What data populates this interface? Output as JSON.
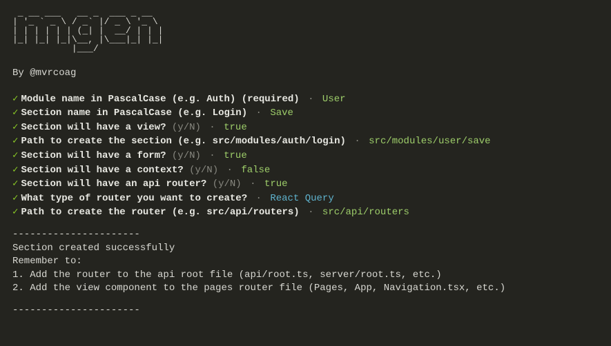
{
  "ascii_art": " _ __ ___   __ _  ___ _ __  \n| '_ ` _ \\ / _` |/ _ \\ '_ \\ \n| | | | | | (_| |  __/ | | |\n|_| |_| |_|\\__, |\\___|_| |_|\n           |___/            ",
  "byline": "By @mvrcoag",
  "prompts": [
    {
      "question": "Module name in PascalCase (e.g. Auth) (required)",
      "hint": "",
      "answer": "User",
      "answer_style": "green"
    },
    {
      "question": "Section name in PascalCase (e.g. Login)",
      "hint": "",
      "answer": "Save",
      "answer_style": "green"
    },
    {
      "question": "Section will have a view?",
      "hint": "(y/N)",
      "answer": "true",
      "answer_style": "green"
    },
    {
      "question": "Path to create the section (e.g. src/modules/auth/login)",
      "hint": "",
      "answer": "src/modules/user/save",
      "answer_style": "green"
    },
    {
      "question": "Section will have a form?",
      "hint": "(y/N)",
      "answer": "true",
      "answer_style": "green"
    },
    {
      "question": "Section will have a context?",
      "hint": "(y/N)",
      "answer": "false",
      "answer_style": "green"
    },
    {
      "question": "Section will have an api router?",
      "hint": "(y/N)",
      "answer": "true",
      "answer_style": "green"
    },
    {
      "question": "What type of router you want to create?",
      "hint": "",
      "answer": "React Query",
      "answer_style": "blue"
    },
    {
      "question": "Path to create the router (e.g. src/api/routers)",
      "hint": "",
      "answer": "src/api/routers",
      "answer_style": "green"
    }
  ],
  "divider": "----------------------",
  "output": {
    "success": "Section created successfully",
    "remember": "Remember to:",
    "step1": "1. Add the router to the api root file (api/root.ts, server/root.ts, etc.)",
    "step2": "2. Add the view component to the pages router file (Pages, App, Navigation.tsx, etc.)"
  },
  "check_symbol": "✓",
  "separator": "·"
}
